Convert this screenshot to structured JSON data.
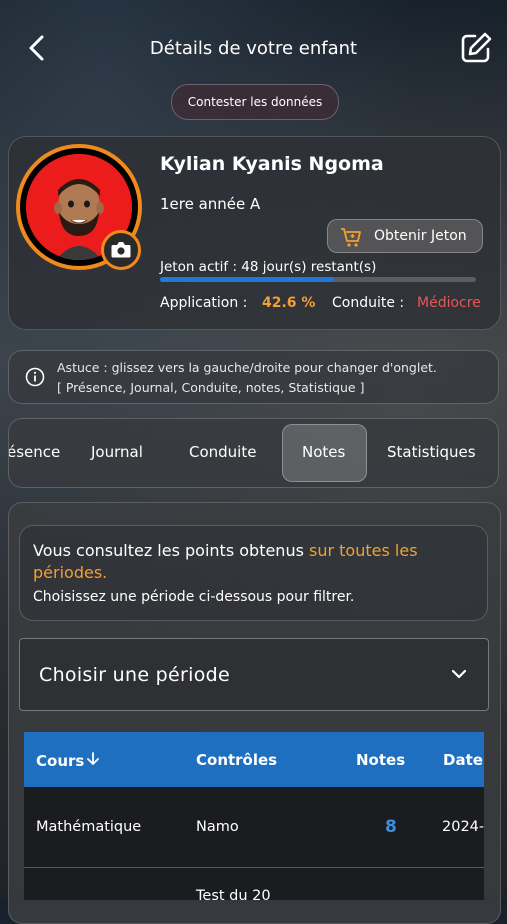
{
  "header": {
    "title": "Détails de votre enfant",
    "contest_label": "Contester les données"
  },
  "profile": {
    "name": "Kylian Kyanis Ngoma",
    "class": "1ere année A",
    "jeton_button": "Obtenir Jeton",
    "jeton_status": "Jeton actif : 48 jour(s) restant(s)",
    "jeton_progress_fraction": 0.55,
    "application_label": "Application :",
    "application_value": "42.6 %",
    "conduite_label": "Conduite :",
    "conduite_value": "Médiocre"
  },
  "tip": {
    "line1": "Astuce : glissez vers la gauche/droite pour changer d'onglet.",
    "line2": "[ Présence, Journal, Conduite, notes, Statistique ]"
  },
  "tabs": {
    "presence": "ésence",
    "journal": "Journal",
    "conduite": "Conduite",
    "notes": "Notes",
    "statistiques": "Statistiques",
    "active": "Notes"
  },
  "info": {
    "text_before": "Vous consultez les points obtenus ",
    "text_highlight": "sur toutes les périodes.",
    "subtext": "Choisissez une période ci-dessous pour filtrer."
  },
  "period_select": {
    "placeholder": "Choisir une période"
  },
  "table": {
    "headers": {
      "cours": "Cours",
      "controles": "Contrôles",
      "notes": "Notes",
      "date": "Date"
    },
    "rows": [
      {
        "cours": "Mathématique",
        "controle": "Namo",
        "note": "8",
        "date": "2024-"
      },
      {
        "cours": "",
        "controle": "Test du 20",
        "note": "",
        "date": ""
      }
    ]
  },
  "colors": {
    "accent_orange": "#f08a1c",
    "progress_blue": "#1e7ad6",
    "table_header_blue": "#1e6fbf",
    "bad_red": "#e45757"
  }
}
